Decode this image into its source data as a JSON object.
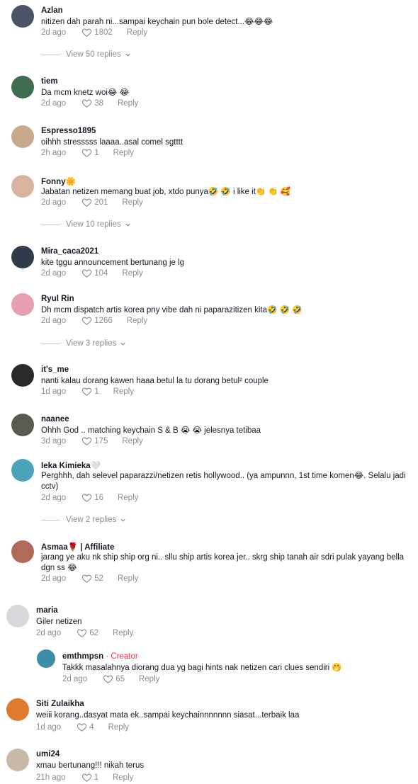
{
  "comments": [
    {
      "name": "Azlan",
      "text": "nitizen dah parah ni...sampai keychain pun bole detect...😂😂😂",
      "time": "2d ago",
      "likes": "1802",
      "reply": "Reply",
      "view_replies": "View 50 replies",
      "avatar_color": "#4a5568"
    },
    {
      "name": "tiem",
      "text": "Da mcm knetz woi😂 😂",
      "time": "2d ago",
      "likes": "38",
      "reply": "Reply",
      "avatar_color": "#3f6b4f"
    },
    {
      "name": "Espresso1895",
      "text": "oihhh stresssss laaaa..asal comel sgtttt",
      "time": "2h ago",
      "likes": "1",
      "reply": "Reply",
      "avatar_color": "#c9a98c"
    },
    {
      "name": "Fonny🌼",
      "text": "Jabatan netizen memang buat job, xtdo punya🤣 🤣 i like it👏 👏 🥰",
      "time": "2d ago",
      "likes": "201",
      "reply": "Reply",
      "view_replies": "View 10 replies",
      "avatar_color": "#d8b4a0"
    },
    {
      "name": "Mira_caca2021",
      "text": "kite tggu announcement bertunang je lg",
      "time": "2d ago",
      "likes": "104",
      "reply": "Reply",
      "avatar_color": "#2f3a4a"
    },
    {
      "name": "Ryul Rin",
      "text": "Dh mcm dispatch artis korea pny vibe dah ni paparazitizen kita🤣 🤣 🤣",
      "time": "2d ago",
      "likes": "1266",
      "reply": "Reply",
      "view_replies": "View 3 replies",
      "avatar_color": "#e8a0b0"
    },
    {
      "name": "it's_me",
      "text": "nanti kalau dorang kawen haaa betul la tu dorang betul² couple",
      "time": "1d ago",
      "likes": "1",
      "reply": "Reply",
      "avatar_color": "#2a2a2a"
    },
    {
      "name": "naanee",
      "text": "Ohhh God .. matching keychain S & B 😭 😭 jelesnya tetibaa",
      "time": "3d ago",
      "likes": "175",
      "reply": "Reply",
      "avatar_color": "#5a5a50"
    },
    {
      "name": "Ieka Kimieka🤍",
      "text": "Perghhh, dah selevel paparazzi/netizen retis hollywood.. (ya ampunnn, 1st time komen😂. Selalu jadi cctv)",
      "time": "2d ago",
      "likes": "16",
      "reply": "Reply",
      "view_replies": "View 2 replies",
      "avatar_color": "#4aa3b8"
    },
    {
      "name": "Asmaa🌹 | Affiliate",
      "text": "jarang ye aku nk ship ship org ni.. sllu ship artis korea jer.. skrg ship tanah air sdri pulak yayang bella dgn ss 😂",
      "time": "2d ago",
      "likes": "52",
      "reply": "Reply",
      "avatar_color": "#b06a5a"
    },
    {
      "name": "maria",
      "text": "Giler netizen",
      "time": "2d ago",
      "likes": "62",
      "reply": "Reply",
      "avatar_color": "#d8d8dc"
    },
    {
      "name": "emthmpsn",
      "creator_label": "· Creator",
      "text": "Takkk masalahnya diorang dua yg bagi hints nak netizen cari clues sendiri 🤭",
      "time": "2d ago",
      "likes": "65",
      "reply": "Reply",
      "avatar_color": "#3b8ea5"
    },
    {
      "name": "Siti Zulaikha",
      "text": "weiii korang..dasyat mata ek..sampai keychainnnnnnn siasat...terbaik laa",
      "time": "1d ago",
      "likes": "4",
      "reply": "Reply",
      "avatar_color": "#e07a2f"
    },
    {
      "name": "umi24",
      "text": "xmau bertunang!!! nikah terus",
      "time": "21h ago",
      "likes": "1",
      "reply": "Reply",
      "avatar_color": "#c8b8a8"
    }
  ]
}
